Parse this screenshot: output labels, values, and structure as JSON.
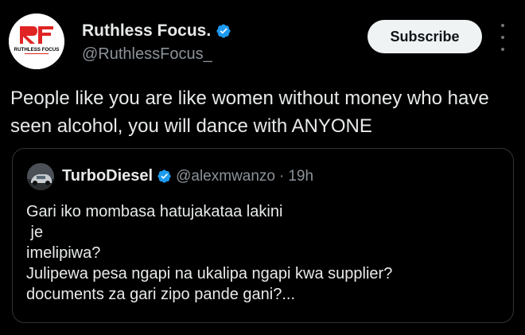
{
  "colors": {
    "background": "#000000",
    "text": "#e7e9ea",
    "secondary_text": "#8b9298",
    "verified_badge": "#1d9bf0",
    "subscribe_bg": "#eff3f4",
    "border": "#2f3336",
    "logo_red": "#e02424"
  },
  "author": {
    "logo_text": "RUTHLESS FOCUS",
    "name": "Ruthless Focus.",
    "handle": "@RuthlessFocus_",
    "verified_icon": "verified-badge-icon"
  },
  "actions": {
    "subscribe_label": "Subscribe",
    "more_icon": "more-vertical-icon"
  },
  "tweet": {
    "text": "People like you are like women without money who have seen alcohol, you will dance with ANYONE"
  },
  "quote": {
    "name": "TurboDiesel",
    "handle": "@alexmwanzo",
    "separator": "·",
    "time": "19h",
    "lines": [
      "Gari iko mombasa hatujakataa lakini",
      " je",
      "imelipiwa?",
      "Julipewa pesa ngapi na ukalipa ngapi kwa supplier?",
      "documents za gari zipo pande gani?..."
    ]
  }
}
